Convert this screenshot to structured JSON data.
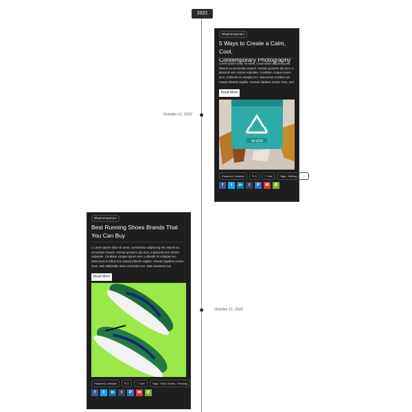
{
  "year": "2022",
  "posts": [
    {
      "date": "October 11, 2022",
      "author": "Blogmanagerpro",
      "title_line1": "5 Ways to Create a Calm, Cool,",
      "title_line2": "Contemporary Photography",
      "excerpt": "Lorem ipsum dolor sit amet, consectetur adipiscing elit. Mauris eu accumsan mauris. Aenean posuere dui arcu, a placerat sem rutrum vulputate. Curabitur congue ipsum sem, a blandit mi volutpat nec. Maecenas et tellus non massa lobortis sagittis. Aenean dapibus ornare risus, sed sollicitudin risus commodo non. Nam maximus non est",
      "read_more": "Read More",
      "category": "Featured, Lifestyle",
      "comments": "0",
      "likes": "Like",
      "tags": "Tags : Editing, Laptop",
      "image": "recycle-cup-photo"
    },
    {
      "date": "October 11, 2022",
      "author": "Blogmanagerpro",
      "title_line1": "Best Running Shoes Brands That",
      "title_line2": "You Can Buy",
      "excerpt": "L Lorem ipsum dolor sit amet, consectetur adipiscing elit. Mauris eu accumsan mauris. Aenean posuere dui arcu, a placerat sem rutrum vulputate. Curabitur congue ipsum sem, a blandit mi volutpat nec. Maecenas et tellus non massa lobortis sagittis. Aenean dapibus ornare risus, sed sollicitudin risus commodo non. Nam maximus non",
      "read_more": "Read More",
      "category": "Featured, Lifestyle",
      "comments": "0",
      "likes": "Like",
      "tags": "Tags : Girls, Shoes, Trending",
      "image": "running-shoes-photo"
    }
  ],
  "share_icons": [
    {
      "name": "facebook-icon",
      "glyph": "f",
      "color": "#3b5998"
    },
    {
      "name": "twitter-icon",
      "glyph": "t",
      "color": "#1da1f2"
    },
    {
      "name": "linkedin-icon",
      "glyph": "in",
      "color": "#0e76a8"
    },
    {
      "name": "tumblr-icon",
      "glyph": "t",
      "color": "#35465c"
    },
    {
      "name": "pinterest-icon",
      "glyph": "P",
      "color": "#2f74c0"
    },
    {
      "name": "email-icon",
      "glyph": "✉",
      "color": "#d23f31"
    },
    {
      "name": "whatsapp-icon",
      "glyph": "✆",
      "color": "#7cab2f"
    }
  ]
}
